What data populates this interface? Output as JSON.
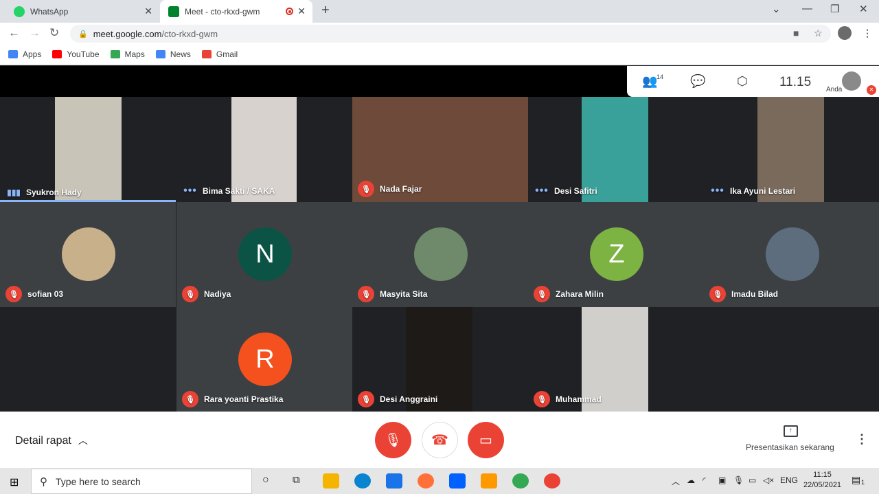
{
  "browser": {
    "tabs": [
      {
        "title": "WhatsApp",
        "active": false,
        "color": "#25d366"
      },
      {
        "title": "Meet - cto-rkxd-gwm",
        "active": true,
        "color": "#00832d"
      }
    ],
    "url_host": "meet.google.com",
    "url_path": "/cto-rkxd-gwm",
    "bookmarks": [
      {
        "label": "Apps",
        "icon": "apps-grid-icon",
        "color": "#4285f4"
      },
      {
        "label": "YouTube",
        "icon": "youtube-icon",
        "color": "#ff0000"
      },
      {
        "label": "Maps",
        "icon": "maps-icon",
        "color": "#34a853"
      },
      {
        "label": "News",
        "icon": "news-icon",
        "color": "#4285f4"
      },
      {
        "label": "Gmail",
        "icon": "gmail-icon",
        "color": "#ea4335"
      }
    ]
  },
  "meet": {
    "participant_count": "14",
    "time": "11.15",
    "self_label": "Anda",
    "tiles": [
      {
        "name": "Syukron Hady",
        "status": "speaking",
        "kind": "video",
        "bg": "#c9c4b8"
      },
      {
        "name": "Bima Sakti / SAKA",
        "status": "dots",
        "kind": "video",
        "bg": "#d8d2cf"
      },
      {
        "name": "Nada Fajar",
        "status": "muted",
        "kind": "video",
        "bg": "#6d4a3a"
      },
      {
        "name": "Desi Safitri",
        "status": "dots",
        "kind": "video",
        "bg": "#3aa09a"
      },
      {
        "name": "Ika Ayuni Lestari",
        "status": "dots",
        "kind": "video",
        "bg": "#7a6a5c"
      },
      {
        "name": "sofian 03",
        "status": "muted",
        "kind": "avatar",
        "avatar_color": "#c7b08a",
        "letter": ""
      },
      {
        "name": "Nadiya",
        "status": "muted",
        "kind": "avatar",
        "avatar_color": "#0b5345",
        "letter": "N"
      },
      {
        "name": "Masyita Sita",
        "status": "muted",
        "kind": "avatar",
        "avatar_color": "#6e8a6a",
        "letter": ""
      },
      {
        "name": "Zahara Milin",
        "status": "muted",
        "kind": "avatar",
        "avatar_color": "#7cb342",
        "letter": "Z"
      },
      {
        "name": "Imadu Bilad",
        "status": "muted",
        "kind": "avatar",
        "avatar_color": "#5d6d7e",
        "letter": ""
      },
      {
        "name": "Rara yoanti Prastika",
        "status": "muted",
        "kind": "avatar",
        "avatar_color": "#f4511e",
        "letter": "R"
      },
      {
        "name": "Desi Anggraini",
        "status": "muted",
        "kind": "video",
        "bg": "#1e1a18"
      },
      {
        "name": "Muhammad",
        "status": "muted",
        "kind": "video",
        "bg": "#d0cfcc"
      }
    ],
    "detail_label": "Detail rapat",
    "present_label": "Presentasikan sekarang",
    "accent": "#ea4335"
  },
  "taskbar": {
    "search_placeholder": "Type here to search",
    "language": "ENG",
    "clock_time": "11:15",
    "clock_date": "22/05/2021",
    "notification_count": "1"
  }
}
